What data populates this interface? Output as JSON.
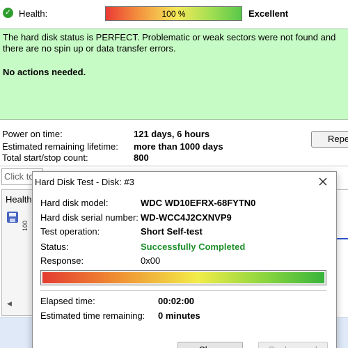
{
  "window": {
    "health": {
      "label": "Health:",
      "bar_text": "100 %",
      "bar_percent": 100,
      "value": "Excellent"
    },
    "status": {
      "message": "The hard disk status is PERFECT. Problematic or weak sectors were not found and there are no spin up or data transfer errors.",
      "action": "No actions needed."
    },
    "info": [
      {
        "label": "Power on time:",
        "value": "121 days, 6 hours"
      },
      {
        "label": "Estimated remaining lifetime:",
        "value": "more than 1000 days"
      },
      {
        "label": "Total start/stop count:",
        "value": "800"
      }
    ],
    "repeat_button_label": "Repe",
    "click_field_text": "Click to",
    "tab_label": "Health",
    "rotated_label": "100",
    "scroll_left_arrow": "◀"
  },
  "dialog": {
    "title": "Hard Disk Test - Disk: #3",
    "fields": [
      {
        "label": "Hard disk model:",
        "value": "WDC WD10EFRX-68FYTN0"
      },
      {
        "label": "Hard disk serial number:",
        "value": "WD-WCC4J2CXNVP9"
      },
      {
        "label": "Test operation:",
        "value": "Short Self-test"
      },
      {
        "label": "Status:",
        "value": "Successfully Completed"
      },
      {
        "label": "Response:",
        "value": "0x00"
      }
    ],
    "progress_percent": 100,
    "elapsed_label": "Elapsed time:",
    "elapsed_value": "00:02:00",
    "remaining_label": "Estimated time remaining:",
    "remaining_value": "0 minutes",
    "close_button": "Close",
    "background_button": "Background"
  },
  "colors": {
    "status_background": "#c7fbc5",
    "success_text": "#1f8f2b",
    "health_icon": "#2e9d2e"
  }
}
